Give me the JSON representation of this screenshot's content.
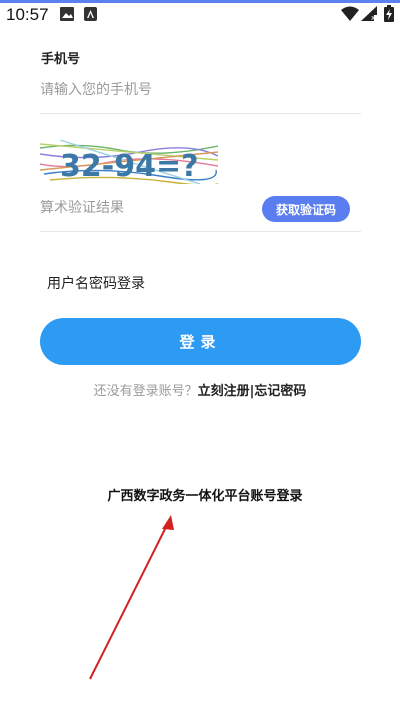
{
  "status_bar": {
    "time": "10:57",
    "icons": [
      "image-icon",
      "app-notification-icon",
      "wifi-icon",
      "signal-icon",
      "battery-icon"
    ]
  },
  "form": {
    "phone_label": "手机号",
    "phone_placeholder": "请输入您的手机号",
    "captcha_image_text": "32-94=?",
    "captcha_placeholder": "算术验证结果",
    "get_code_label": "获取验证码",
    "switch_login_label": "用户名密码登录",
    "login_label": "登录"
  },
  "register_line": {
    "prefix": "还没有登录账号？",
    "register_link": "立刻注册",
    "separator": "|",
    "forgot_link": "忘记密码"
  },
  "gx_login_label": "广西数字政务一体化平台账号登录",
  "colors": {
    "accent_line": "#5d7ff0",
    "get_code_button": "#5a7df0",
    "login_button": "#2d9af3",
    "arrow": "#d42020"
  }
}
